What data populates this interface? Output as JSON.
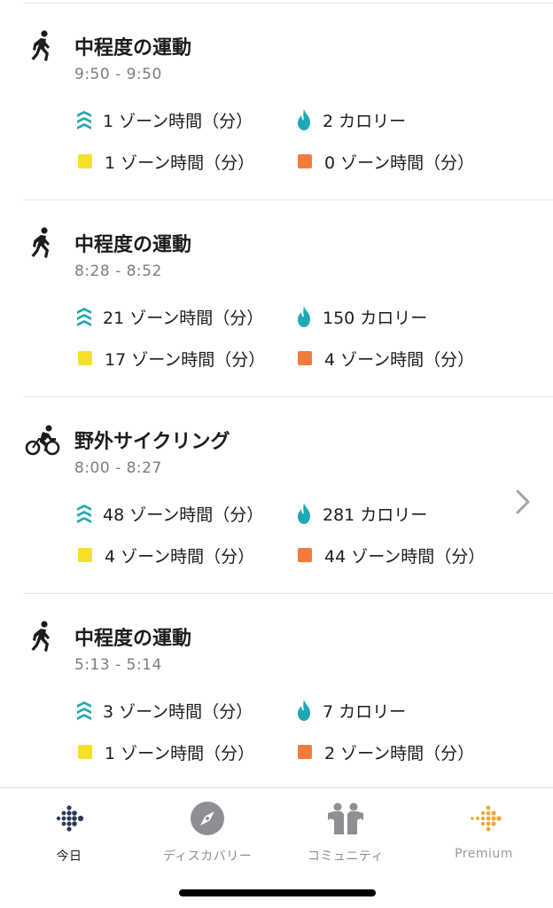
{
  "colors": {
    "teal": "#1fa8b4",
    "yellow": "#f5e12a",
    "orange": "#f27b3c",
    "premium_gold": "#e9a93a",
    "dark_text": "#1c1c1e",
    "gray_text": "#7a7d84"
  },
  "activities": [
    {
      "icon": "walking-icon",
      "title": "中程度の運動",
      "time": "9:50 - 9:50",
      "zone_total": "1 ゾーン時間（分）",
      "calories": "2 カロリー",
      "fat_burn": "1 ゾーン時間（分）",
      "cardio": "0 ゾーン時間（分）"
    },
    {
      "icon": "walking-icon",
      "title": "中程度の運動",
      "time": "8:28 - 8:52",
      "zone_total": "21 ゾーン時間（分）",
      "calories": "150 カロリー",
      "fat_burn": "17 ゾーン時間（分）",
      "cardio": "4 ゾーン時間（分）"
    },
    {
      "icon": "cycling-icon",
      "title": "野外サイクリング",
      "time": "8:00 - 8:27",
      "zone_total": "48 ゾーン時間（分）",
      "calories": "281 カロリー",
      "fat_burn": "4 ゾーン時間（分）",
      "cardio": "44 ゾーン時間（分）",
      "has_chevron": true
    },
    {
      "icon": "walking-icon",
      "title": "中程度の運動",
      "time": "5:13 - 5:14",
      "zone_total": "3 ゾーン時間（分）",
      "calories": "7 カロリー",
      "fat_burn": "1 ゾーン時間（分）",
      "cardio": "2 ゾーン時間（分）"
    }
  ],
  "tabs": [
    {
      "label": "今日",
      "icon": "fitbit-logo-icon",
      "active": true
    },
    {
      "label": "ディスカバリー",
      "icon": "compass-icon",
      "active": false
    },
    {
      "label": "コミュニティ",
      "icon": "community-icon",
      "active": false
    },
    {
      "label": "Premium",
      "icon": "premium-icon",
      "active": false
    }
  ]
}
